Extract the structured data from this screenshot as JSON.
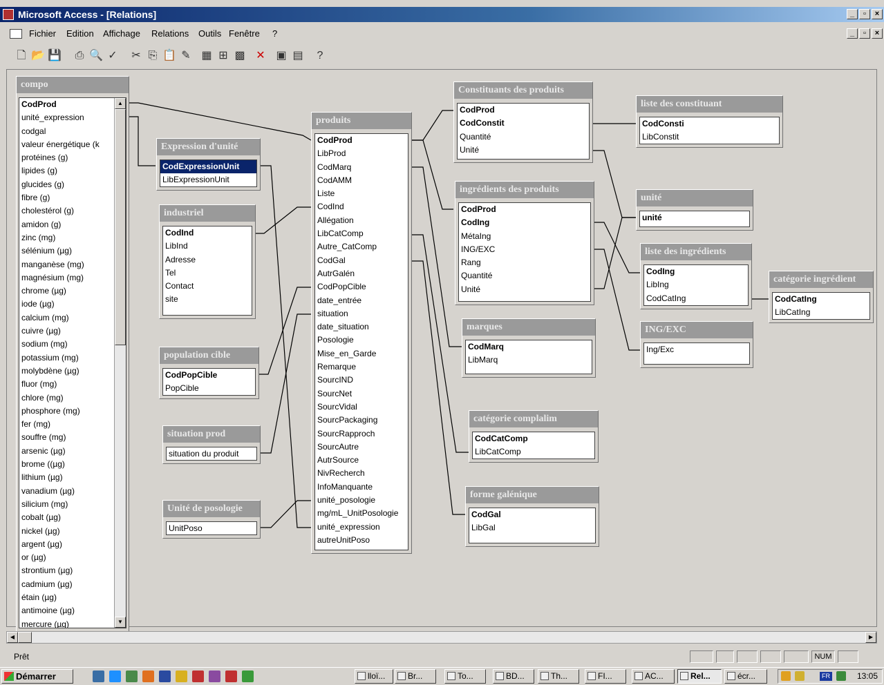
{
  "window": {
    "title": "Microsoft Access - [Relations]",
    "controls": [
      "_",
      "▫",
      "×"
    ]
  },
  "menu": [
    "Fichier",
    "Edition",
    "Affichage",
    "Relations",
    "Outils",
    "Fenêtre",
    "?"
  ],
  "tables": {
    "compo": {
      "title": "compo",
      "fields": [
        "CodProd",
        "unité_expression",
        "codgal",
        "valeur énergétique (k",
        "protéines (g)",
        "lipides (g)",
        "glucides (g)",
        "fibre (g)",
        "cholestérol (g)",
        "amidon (g)",
        "zinc (mg)",
        "sélénium (µg)",
        "manganèse (mg)",
        "magnésium (mg)",
        "chrome (µg)",
        "iode (µg)",
        "calcium (mg)",
        "cuivre (µg)",
        "sodium (mg)",
        "potassium (mg)",
        "molybdène (µg)",
        "fluor (mg)",
        "chlore (mg)",
        "phosphore (mg)",
        "fer (mg)",
        "souffre (mg)",
        "arsenic (µg)",
        "brome ((µg)",
        "lithium (µg)",
        "vanadium (µg)",
        "silicium (mg)",
        "cobalt (µg)",
        "nickel (µg)",
        "argent (µg)",
        "or (µg)",
        "strontium (µg)",
        "cadmium (µg)",
        "étain (µg)",
        "antimoine (µg)",
        "mercure (µg)"
      ]
    },
    "expression": {
      "title": "Expression d'unité",
      "fields": [
        "CodExpressionUnit",
        "LibExpressionUnit"
      ]
    },
    "industriel": {
      "title": "industriel",
      "fields": [
        "CodInd",
        "LibInd",
        "Adresse",
        "Tel",
        "Contact",
        "site"
      ]
    },
    "population": {
      "title": "population cible",
      "fields": [
        "CodPopCible",
        "PopCible"
      ]
    },
    "situation": {
      "title": "situation prod",
      "fields": [
        "situation du produit"
      ]
    },
    "posologie": {
      "title": "Unité de posologie",
      "fields": [
        "UnitPoso"
      ]
    },
    "produits": {
      "title": "produits",
      "fields": [
        "CodProd",
        "LibProd",
        "CodMarq",
        "CodAMM",
        "Liste",
        "CodInd",
        "Allégation",
        "LibCatComp",
        "Autre_CatComp",
        "CodGal",
        "AutrGalén",
        "CodPopCible",
        "date_entrée",
        "situation",
        "date_situation",
        "Posologie",
        "Mise_en_Garde",
        "Remarque",
        "SourcIND",
        "SourcNet",
        "SourcVidal",
        "SourcPackaging",
        "SourcRapproch",
        "SourcAutre",
        "AutrSource",
        "NivRecherch",
        "InfoManquante",
        "unité_posologie",
        "mg/mL_UnitPosologie",
        "unité_expression",
        "autreUnitPoso"
      ]
    },
    "constituants": {
      "title": "Constituants des produits",
      "fields": [
        "CodProd",
        "CodConstit",
        "Quantité",
        "Unité"
      ]
    },
    "ingredients": {
      "title": "ingrédients des produits",
      "fields": [
        "CodProd",
        "CodIng",
        "MétaIng",
        "ING/EXC",
        "Rang",
        "Quantité",
        "Unité"
      ]
    },
    "marques": {
      "title": "marques",
      "fields": [
        "CodMarq",
        "LibMarq"
      ]
    },
    "catcomp": {
      "title": "catégorie complalim",
      "fields": [
        "CodCatComp",
        "LibCatComp"
      ]
    },
    "forme": {
      "title": "forme galénique",
      "fields": [
        "CodGal",
        "LibGal"
      ]
    },
    "listeconst": {
      "title": "liste des constituant",
      "fields": [
        "CodConsti",
        "LibConstit"
      ]
    },
    "unite": {
      "title": "unité",
      "fields": [
        "unité"
      ]
    },
    "listeing": {
      "title": "liste des ingrédients",
      "fields": [
        "CodIng",
        "LibIng",
        "CodCatIng"
      ]
    },
    "ingexc": {
      "title": "ING/EXC",
      "fields": [
        "Ing/Exc"
      ]
    },
    "catingr": {
      "title": "catégorie ingrédient",
      "fields": [
        "CodCatIng",
        "LibCatIng"
      ]
    }
  },
  "status": {
    "text": "Prêt",
    "num": "NUM"
  },
  "taskbar": {
    "start": "Démarrer",
    "tasks": [
      "lloï...",
      "Br...",
      "To...",
      "BD...",
      "Th...",
      "FI...",
      "AC...",
      "Rel...",
      "écr..."
    ],
    "lang": "FR",
    "clock": "13:05"
  }
}
